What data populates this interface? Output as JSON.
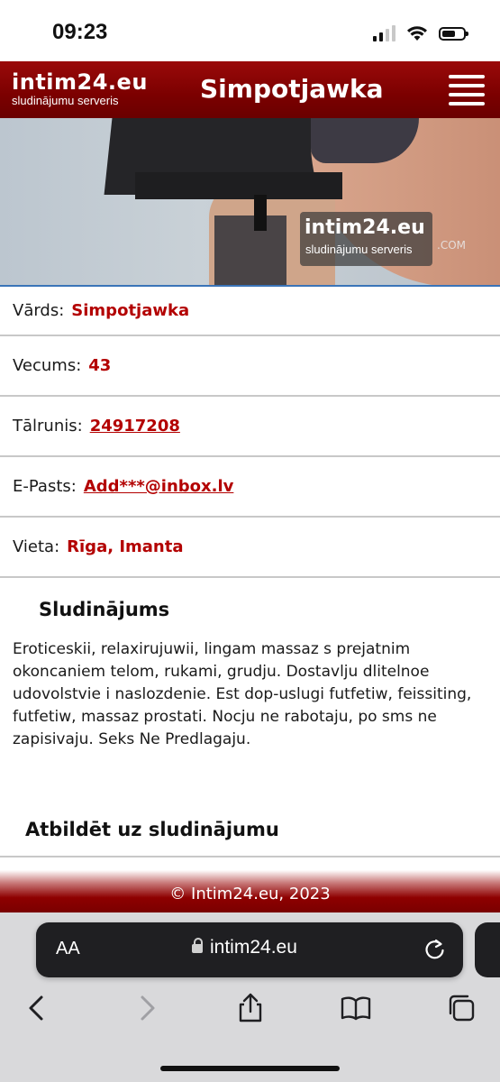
{
  "status_bar": {
    "time": "09:23"
  },
  "header": {
    "logo_main": "intim24.eu",
    "logo_sub": "sludinājumu serveris",
    "title": "Simpotjawka"
  },
  "hero": {
    "watermark_main": "intim24.eu",
    "watermark_sub": "sludinājumu serveris",
    "watermark_com": ".COM"
  },
  "info": {
    "name_label": "Vārds:",
    "name_value": "Simpotjawka",
    "age_label": "Vecums:",
    "age_value": "43",
    "phone_label": "Tālrunis:",
    "phone_value": "24917208",
    "email_label": "E-Pasts:",
    "email_value": "Add***@inbox.lv",
    "location_label": "Vieta:",
    "location_value": "Rīga, Imanta"
  },
  "ad": {
    "heading": "Sludinājums",
    "text": "Eroticeskii, relaxirujuwii, lingam massaz s prejatnim okoncaniem telom, rukami, grudju. Dostavlju dlitelnoe udovolstvie i naslozdenie. Est dop-uslugi futfetiw, feissiting, futfetiw, massaz prostati. Nocju ne rabotaju, po sms ne zapisivaju. Seks Ne Predlagaju."
  },
  "reply": {
    "heading": "Atbildēt uz sludinājumu"
  },
  "footer": {
    "text": "© Intim24.eu, 2023"
  },
  "browser": {
    "aa_label": "AA",
    "url": "intim24.eu"
  },
  "colors": {
    "brand_red": "#7b0000",
    "accent_red": "#b30000",
    "link_blue": "#3a74b8"
  },
  "icons": [
    "signal-icon",
    "wifi-icon",
    "battery-icon",
    "menu-icon",
    "lock-icon",
    "reload-icon",
    "back-icon",
    "forward-icon",
    "share-icon",
    "bookmarks-icon",
    "tabs-icon"
  ]
}
